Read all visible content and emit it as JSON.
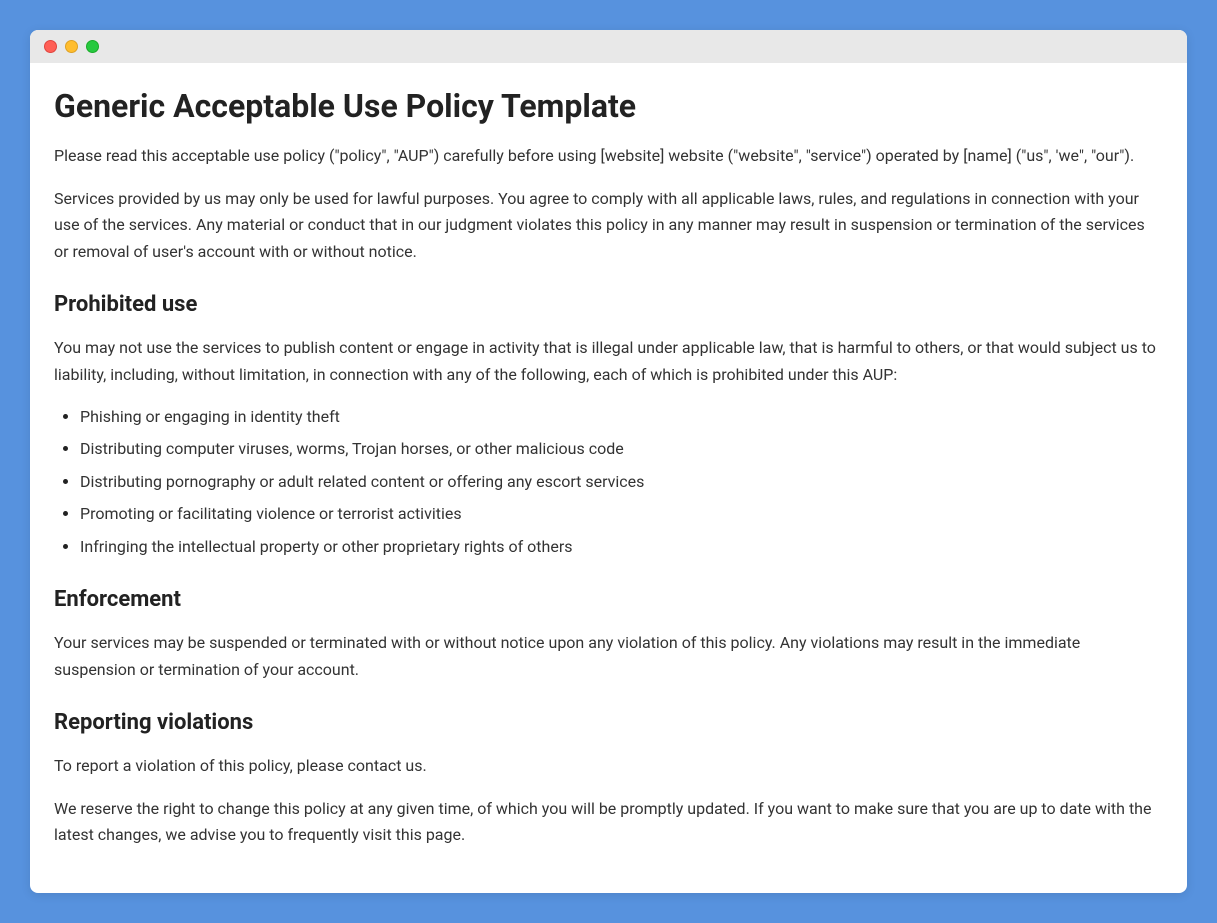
{
  "title": "Generic Acceptable Use Policy Template",
  "intro": [
    "Please read this acceptable use policy (\"policy\", \"AUP\") carefully before using [website] website (\"website\", \"service\") operated by [name] (\"us\", 'we\", \"our\").",
    "Services provided by us may only be used for lawful purposes. You agree to comply with all applicable laws, rules, and regulations in connection with your use of the services. Any material or conduct that in our judgment violates this policy in any manner may result in suspension or termination of the services or removal of user's account with or without notice."
  ],
  "sections": {
    "prohibited": {
      "heading": "Prohibited use",
      "body": "You may not use the services to publish content or engage in activity that is illegal under applicable law, that is harmful to others, or that would subject us to liability, including, without limitation, in connection with any of the following, each of which is prohibited under this AUP:",
      "items": [
        "Phishing or engaging in identity theft",
        "Distributing computer viruses, worms, Trojan horses, or other malicious code",
        "Distributing pornography or adult related content or offering any escort services",
        "Promoting or facilitating violence or terrorist activities",
        "Infringing the intellectual property or other proprietary rights of others"
      ]
    },
    "enforcement": {
      "heading": "Enforcement",
      "body": "Your services may be suspended or terminated with or without notice upon any violation of this policy. Any violations may result in the immediate suspension or termination of your account."
    },
    "reporting": {
      "heading": "Reporting violations",
      "paragraphs": [
        "To report a violation of this policy, please contact us.",
        "We reserve the right to change this policy at any given time, of which you will be promptly updated. If you want to make sure that you are up to date with the latest changes, we advise you to frequently visit this page."
      ]
    }
  }
}
